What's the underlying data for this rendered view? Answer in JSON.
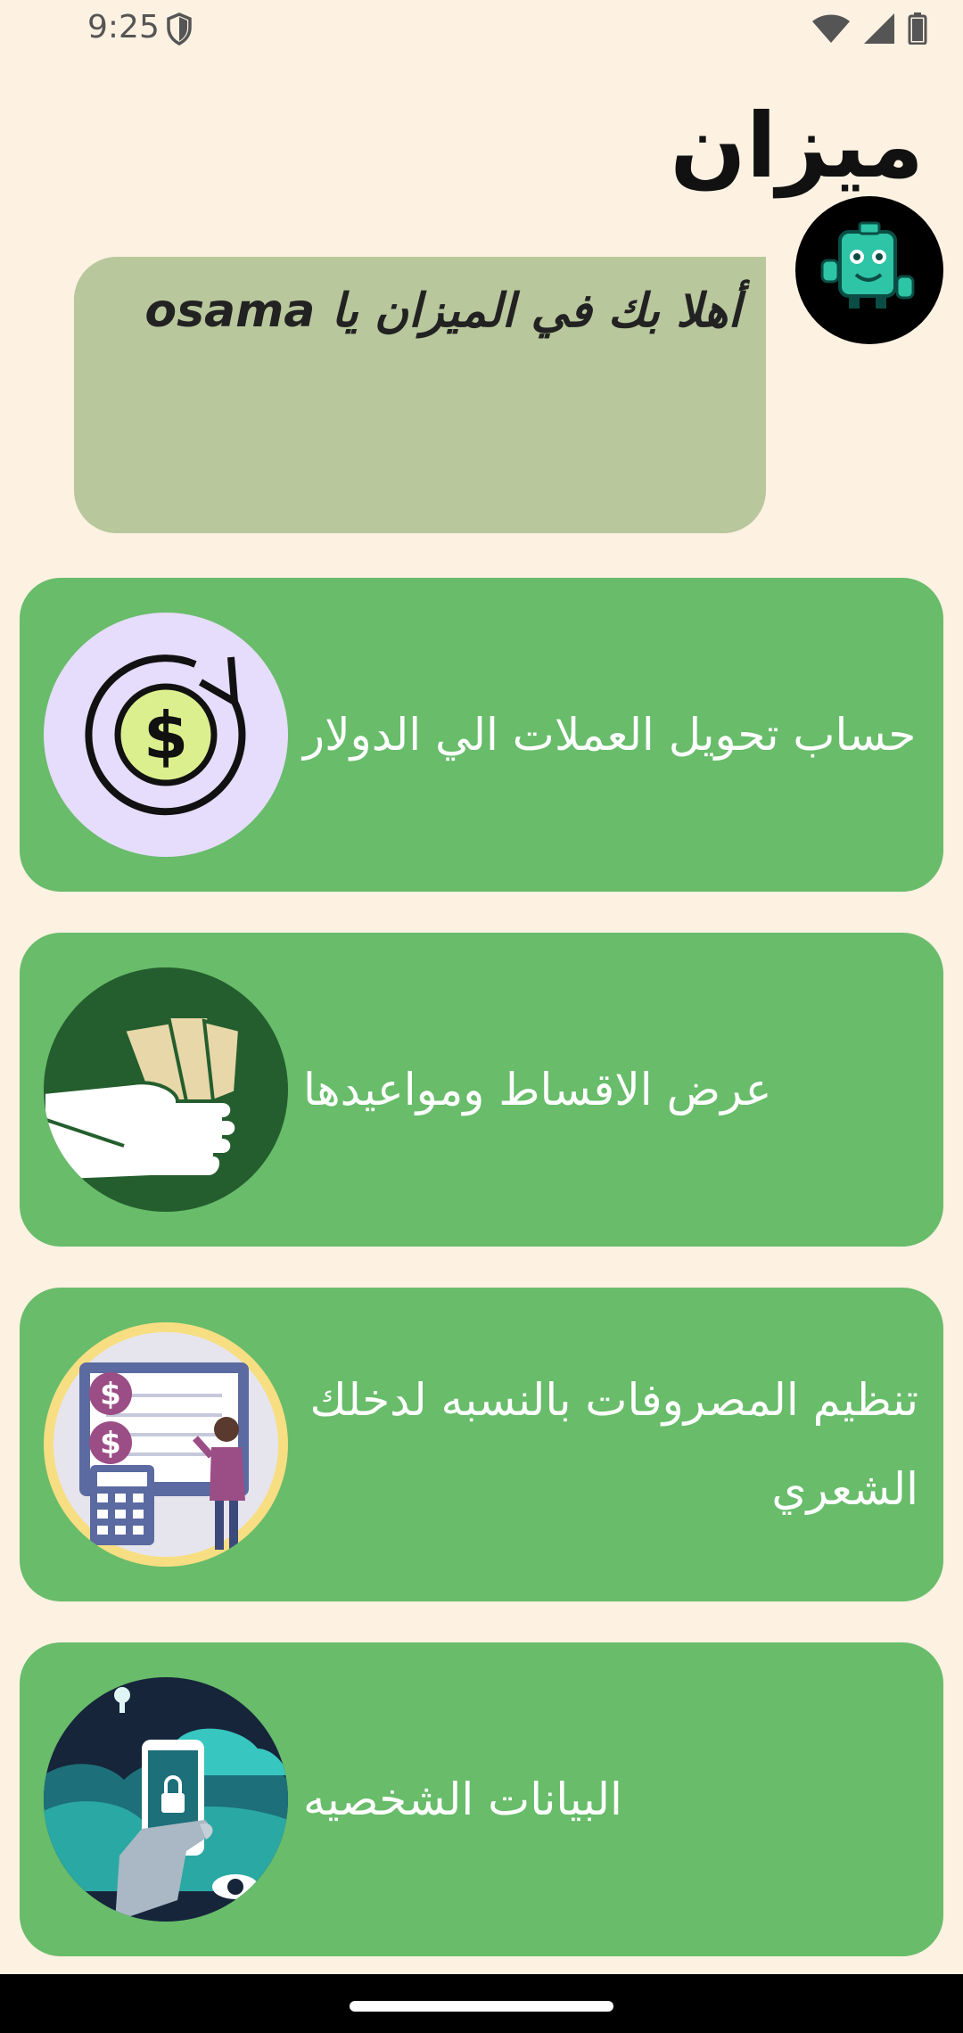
{
  "status_bar": {
    "time": "9:25"
  },
  "app": {
    "title": "ميزان"
  },
  "welcome": {
    "text": "أهلا بك في الميزان يا osama"
  },
  "cards": [
    {
      "label": "حساب تحويل العملات الي الدولار",
      "icon": "currency-exchange-icon"
    },
    {
      "label": "عرض الاقساط ومواعيدها",
      "icon": "money-hand-icon"
    },
    {
      "label": "تنظيم المصروفات بالنسبه لدخلك الشعري",
      "icon": "expense-calculator-icon"
    },
    {
      "label": "البيانات الشخصيه",
      "icon": "secure-phone-icon"
    }
  ],
  "colors": {
    "background": "#fdf1e2",
    "card": "#68bc6a",
    "welcome_box": "#b8c79c",
    "nav_bar": "#000000"
  }
}
